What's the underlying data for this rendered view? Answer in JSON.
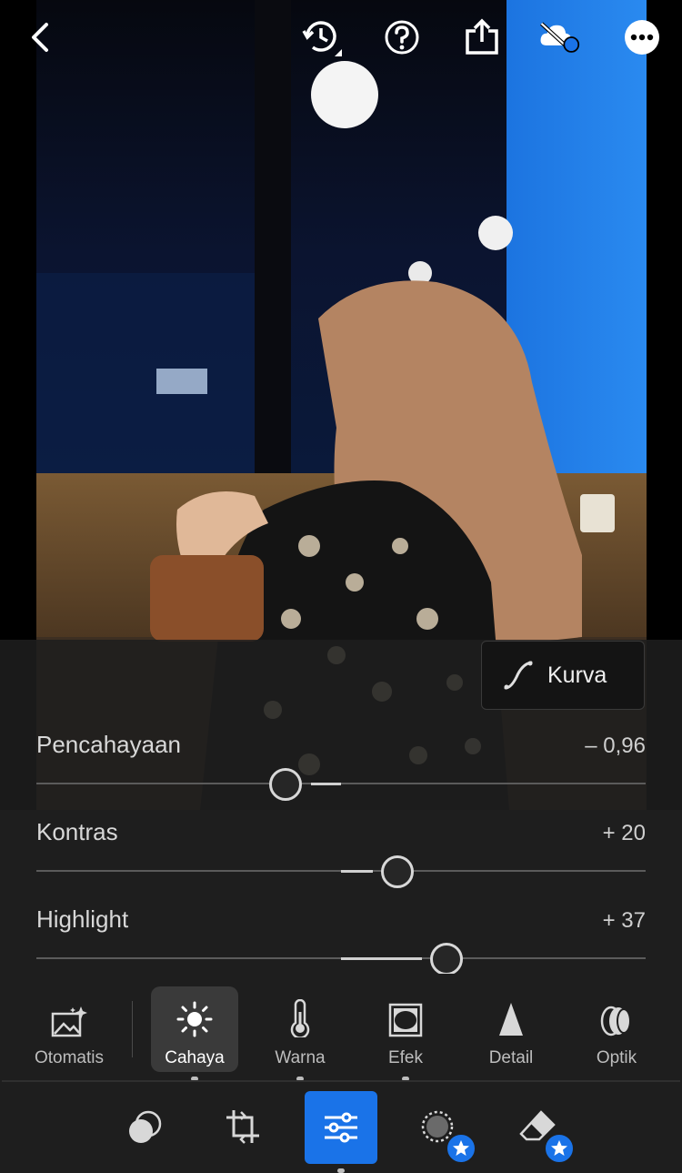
{
  "topbar": {
    "back_icon": "chevron-left-icon",
    "icons": [
      "history-icon",
      "help-icon",
      "share-icon",
      "cloud-sync-off-icon",
      "more-icon"
    ]
  },
  "curve_button": {
    "label": "Kurva",
    "icon": "curve-icon"
  },
  "sliders": [
    {
      "label": "Pencahayaan",
      "value": "– 0,96",
      "level": -0.192
    },
    {
      "label": "Kontras",
      "value": "+ 20",
      "level": 0.2
    },
    {
      "label": "Highlight",
      "value": "+ 37",
      "level": 0.37
    }
  ],
  "tool_tabs": [
    {
      "label": "Otomatis",
      "icon": "auto-image-icon",
      "active": false,
      "modified": false
    },
    {
      "label": "Cahaya",
      "icon": "sun-icon",
      "active": true,
      "modified": true
    },
    {
      "label": "Warna",
      "icon": "thermometer-icon",
      "active": false,
      "modified": true
    },
    {
      "label": "Efek",
      "icon": "vignette-icon",
      "active": false,
      "modified": true
    },
    {
      "label": "Detail",
      "icon": "triangle-icon",
      "active": false,
      "modified": false
    },
    {
      "label": "Optik",
      "icon": "lens-icon",
      "active": false,
      "modified": false
    }
  ],
  "bottom_toolbar": [
    {
      "icon": "selective-edit-icon",
      "premium": false
    },
    {
      "icon": "crop-icon",
      "premium": false
    },
    {
      "icon": "adjust-sliders-icon",
      "premium": false,
      "active": true
    },
    {
      "icon": "healing-icon",
      "premium": true
    },
    {
      "icon": "eraser-icon",
      "premium": true
    }
  ],
  "colors": {
    "accent": "#1a73e8",
    "panel": "#1e1e1e",
    "text": "#d8d8d8"
  }
}
